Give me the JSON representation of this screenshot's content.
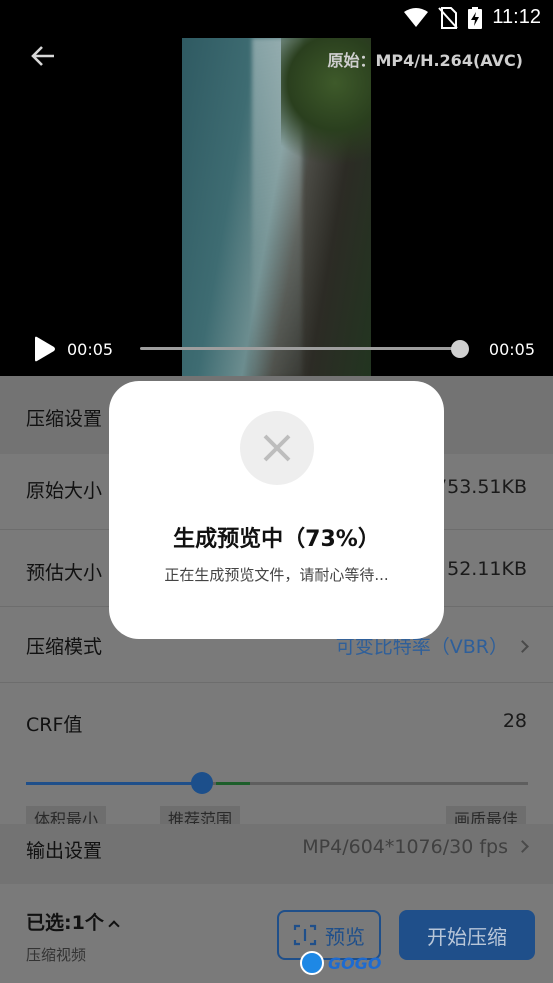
{
  "status_bar": {
    "time": "11:12",
    "icons": [
      "wifi-icon",
      "no-sim-icon",
      "battery-charging-icon"
    ]
  },
  "video": {
    "format_label": "原始：MP4/H.264(AVC)",
    "current_time": "00:05",
    "total_time": "00:05",
    "progress": 1.0
  },
  "settings": {
    "compress_settings_label": "压缩设置",
    "original_size_label": "原始大小",
    "original_size_value": "753.51KB",
    "estimated_size_label": "预估大小",
    "estimated_size_value": "52.11KB",
    "mode_label": "压缩模式",
    "mode_value": "可变比特率（VBR）",
    "crf_label": "CRF值",
    "crf_value": "28",
    "crf_position": 0.35,
    "ticks": [
      "体积最小",
      "推荐范围",
      "画质最佳"
    ],
    "output_label": "输出设置",
    "output_value": "MP4/604*1076/30 fps"
  },
  "bottom": {
    "selected_label": "已选:1个",
    "sub_label": "压缩视频",
    "preview_button": "预览",
    "start_button": "开始压缩",
    "watermark": "GOGO"
  },
  "dialog": {
    "title": "生成预览中（73%）",
    "message": "正在生成预览文件，请耐心等待...",
    "progress_percent": 73
  }
}
